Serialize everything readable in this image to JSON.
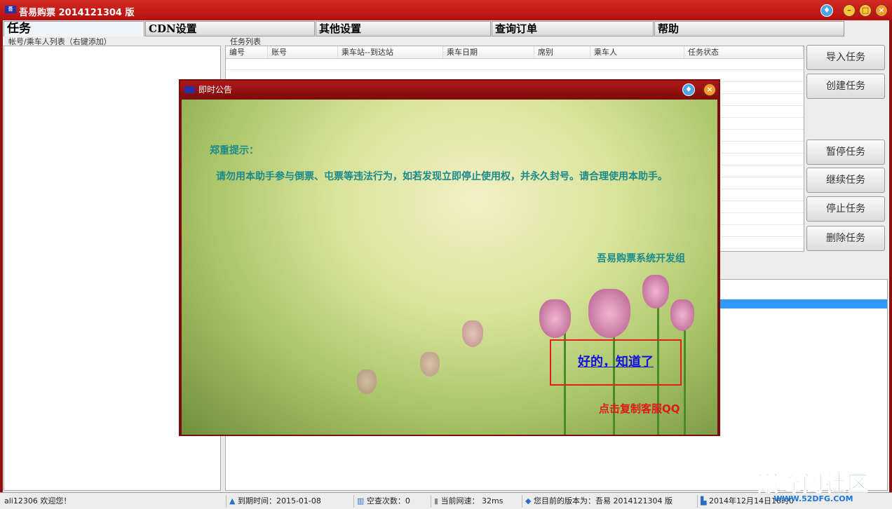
{
  "window": {
    "title": "吾易购票 2014121304 版",
    "logo": "吾易"
  },
  "tabs": [
    {
      "label": "任务"
    },
    {
      "label": "CDN设置"
    },
    {
      "label": "其他设置"
    },
    {
      "label": "查询订单"
    },
    {
      "label": "帮助"
    }
  ],
  "left_panel": {
    "label": "帐号/乘车人列表（右键添加）"
  },
  "task_list": {
    "label": "任务列表",
    "columns": [
      "编号",
      "账号",
      "乘车站--到达站",
      "乘车日期",
      "席别",
      "乘车人",
      "任务状态"
    ]
  },
  "buttons": {
    "import": "导入任务",
    "create": "创建任务",
    "pause": "暂停任务",
    "resume": "继续任务",
    "stop": "停止任务",
    "delete": "删除任务"
  },
  "status": {
    "user": "ali12306 欢迎您！",
    "expire": "到期时间：2015-01-08",
    "empty_count": "空查次数：0",
    "speed": "当前网速： 32ms",
    "version": "您目前的版本为：吾易 2014121304 版",
    "datetime": "2014年12月14日16时0"
  },
  "dialog": {
    "title": "即时公告",
    "heading": "郑重提示：",
    "body": "请勿用本助手参与倒票、屯票等违法行为，如若发现立即停止使用权，并永久封号。请合理使用本助手。",
    "signature": "吾易购票系统开发组",
    "ok": "好的，知道了",
    "copy_qq": "点击复制客服QQ"
  },
  "watermark": {
    "text": "巅峰阁社区",
    "url": "WWW.52DFG.COM"
  },
  "colors": {
    "title_red": "#c41e1a",
    "selection": "#3399ff",
    "link": "#1010e0"
  }
}
